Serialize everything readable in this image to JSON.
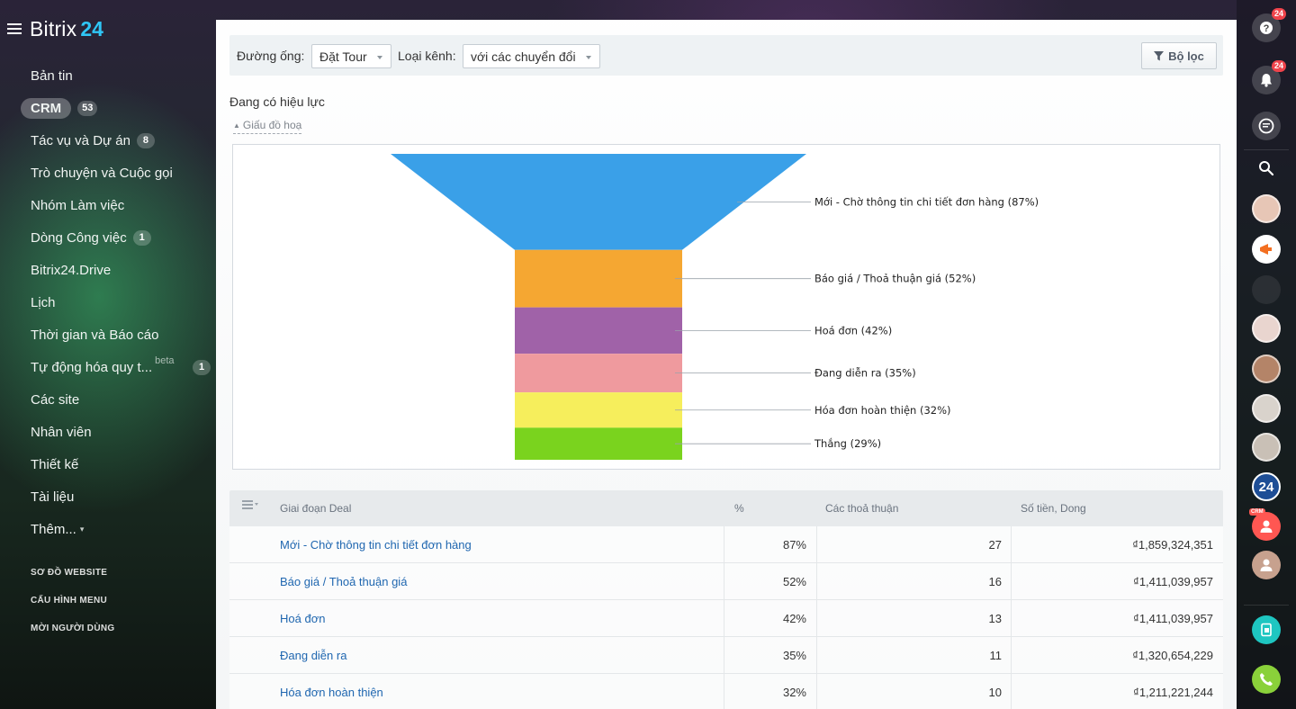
{
  "brand": {
    "name": "Bitrix",
    "number": "24"
  },
  "sidebar": {
    "items": [
      {
        "label": "Bản tin"
      },
      {
        "label": "CRM",
        "badge": "53",
        "active": true
      },
      {
        "label": "Tác vụ và Dự án",
        "badge": "8"
      },
      {
        "label": "Trò chuyện và Cuộc gọi"
      },
      {
        "label": "Nhóm Làm việc"
      },
      {
        "label": "Dòng Công việc",
        "badge": "1"
      },
      {
        "label": "Bitrix24.Drive"
      },
      {
        "label": "Lịch"
      },
      {
        "label": "Thời gian và Báo cáo"
      },
      {
        "label": "Tự động hóa quy t...",
        "sup": "beta",
        "badge": "1"
      },
      {
        "label": "Các site"
      },
      {
        "label": "Nhân viên"
      },
      {
        "label": "Thiết kế"
      },
      {
        "label": "Tài liệu"
      },
      {
        "label": "Thêm..."
      }
    ],
    "footer": [
      "SƠ ĐỒ WEBSITE",
      "CẤU HÌNH MENU",
      "MỜI NGƯỜI DÙNG"
    ]
  },
  "rightbar": {
    "help_count": "24",
    "notif_count": "24",
    "logo_24": "24",
    "crm_tag": "CRM"
  },
  "filter": {
    "pipeline_label": "Đường ống:",
    "pipeline_value": "Đặt Tour",
    "channel_label": "Loại kênh:",
    "channel_value": "với các chuyển đổi",
    "filter_button": "Bộ lọc"
  },
  "section_title": "Đang có hiệu lực",
  "hide_chart": "Giấu đồ hoạ",
  "chart_data": {
    "type": "funnel",
    "stages": [
      {
        "label": "Mới - Chờ thông tin chi tiết đơn hàng (87%)",
        "percent": 87,
        "color": "#3aa0e8"
      },
      {
        "label": "Báo giá / Thoả thuận giá (52%)",
        "percent": 52,
        "color": "#f5a732"
      },
      {
        "label": "Hoá đơn (42%)",
        "percent": 42,
        "color": "#a062a8"
      },
      {
        "label": "Đang diễn ra (35%)",
        "percent": 35,
        "color": "#ef9a9e"
      },
      {
        "label": "Hóa đơn hoàn thiện (32%)",
        "percent": 32,
        "color": "#f6ee5c"
      },
      {
        "label": "Thắng (29%)",
        "percent": 29,
        "color": "#7ad31e"
      }
    ]
  },
  "table": {
    "columns": [
      "Giai đoạn Deal",
      "%",
      "Các thoả thuận",
      "Số tiền, Dong"
    ],
    "rows": [
      {
        "stage": "Mới - Chờ thông tin chi tiết đơn hàng",
        "percent": "87%",
        "deals": "27",
        "amount": "₫1,859,324,351"
      },
      {
        "stage": "Báo giá / Thoả thuận giá",
        "percent": "52%",
        "deals": "16",
        "amount": "₫1,411,039,957"
      },
      {
        "stage": "Hoá đơn",
        "percent": "42%",
        "deals": "13",
        "amount": "₫1,411,039,957"
      },
      {
        "stage": "Đang diễn ra",
        "percent": "35%",
        "deals": "11",
        "amount": "₫1,320,654,229"
      },
      {
        "stage": "Hóa đơn hoàn thiện",
        "percent": "32%",
        "deals": "10",
        "amount": "₫1,211,221,244"
      }
    ]
  }
}
